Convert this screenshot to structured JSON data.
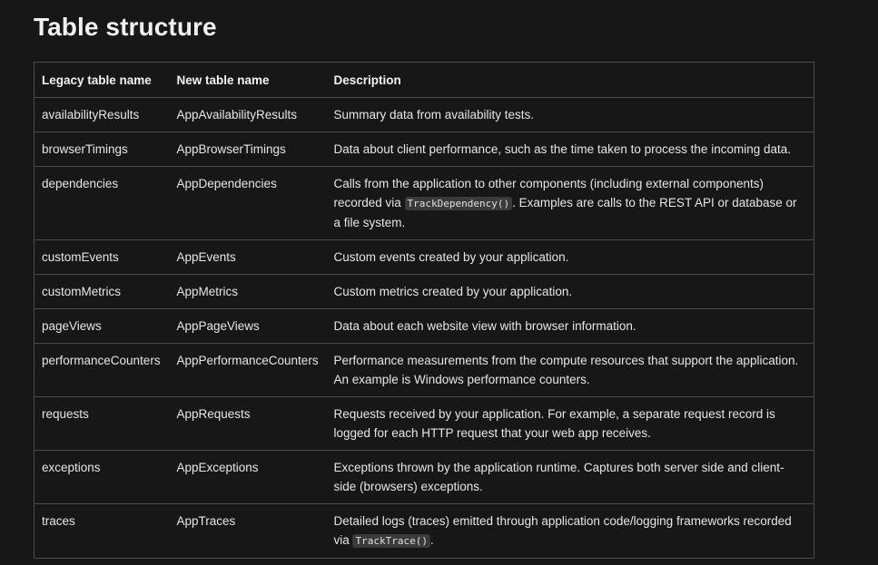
{
  "section_title": "Table structure",
  "table": {
    "headers": [
      "Legacy table name",
      "New table name",
      "Description"
    ],
    "rows": [
      {
        "legacy": "availabilityResults",
        "new": "AppAvailabilityResults",
        "desc_before": "Summary data from availability tests.",
        "code": "",
        "desc_after": ""
      },
      {
        "legacy": "browserTimings",
        "new": "AppBrowserTimings",
        "desc_before": "Data about client performance, such as the time taken to process the incoming data.",
        "code": "",
        "desc_after": ""
      },
      {
        "legacy": "dependencies",
        "new": "AppDependencies",
        "desc_before": "Calls from the application to other components (including external components) recorded via ",
        "code": "TrackDependency()",
        "desc_after": ". Examples are calls to the REST API or database or a file system."
      },
      {
        "legacy": "customEvents",
        "new": "AppEvents",
        "desc_before": "Custom events created by your application.",
        "code": "",
        "desc_after": ""
      },
      {
        "legacy": "customMetrics",
        "new": "AppMetrics",
        "desc_before": "Custom metrics created by your application.",
        "code": "",
        "desc_after": ""
      },
      {
        "legacy": "pageViews",
        "new": "AppPageViews",
        "desc_before": "Data about each website view with browser information.",
        "code": "",
        "desc_after": ""
      },
      {
        "legacy": "performanceCounters",
        "new": "AppPerformanceCounters",
        "desc_before": "Performance measurements from the compute resources that support the application. An example is Windows performance counters.",
        "code": "",
        "desc_after": ""
      },
      {
        "legacy": "requests",
        "new": "AppRequests",
        "desc_before": "Requests received by your application. For example, a separate request record is logged for each HTTP request that your web app receives.",
        "code": "",
        "desc_after": ""
      },
      {
        "legacy": "exceptions",
        "new": "AppExceptions",
        "desc_before": "Exceptions thrown by the application runtime. Captures both server side and client-side (browsers) exceptions.",
        "code": "",
        "desc_after": ""
      },
      {
        "legacy": "traces",
        "new": "AppTraces",
        "desc_before": "Detailed logs (traces) emitted through application code/logging frameworks recorded via ",
        "code": "TrackTrace()",
        "desc_after": "."
      }
    ]
  }
}
